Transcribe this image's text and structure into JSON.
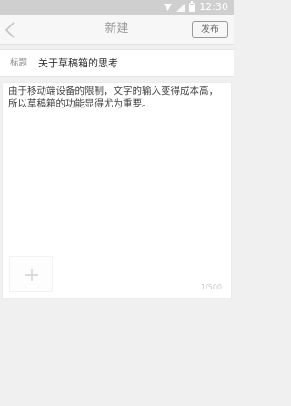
{
  "status_bar": {
    "time": "12:30",
    "icons": [
      "wifi-icon",
      "signal-icon",
      "battery-icon"
    ]
  },
  "nav": {
    "title": "新建",
    "publish_label": "发布",
    "back_icon": "chevron-left-icon"
  },
  "form": {
    "title_label": "标题",
    "title_value": "关于草稿箱的思考",
    "body_value": "由于移动端设备的限制，文字的输入变得成本高，所以草稿箱的功能显得尤为重要。",
    "add_image_icon": "plus-icon",
    "char_count": "1/500"
  },
  "colors": {
    "status_bar_bg": "#cfcfcf",
    "nav_bg": "#f7f7f7",
    "page_bg": "#f0f0f0",
    "text_primary": "#333333"
  }
}
